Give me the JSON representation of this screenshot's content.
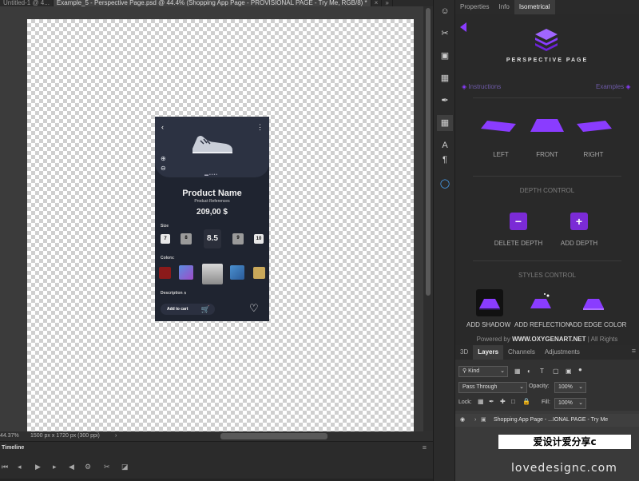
{
  "document_tabs": [
    {
      "label": "Untitled-1 @ 4...",
      "active": false
    },
    {
      "label": "Example_5 - Perspective Page.psd @ 44.4% (Shopping App Page - PROVISIONAL PAGE - Try Me, RGB/8) *",
      "active": true
    },
    {
      "label": "×",
      "active": false
    },
    {
      "label": "»",
      "active": false
    }
  ],
  "phone": {
    "product_name": "Product Name",
    "product_ref": "Product References",
    "price": "209,00 $",
    "size_label": "Size",
    "sizes": [
      "7",
      "8",
      "8.5",
      "9",
      "10"
    ],
    "colors_label": "Colors:",
    "description_label": "Description ∧",
    "add_to_cart": "Add to cart",
    "colors": [
      "#8b1a1a",
      "#7a5ab8",
      "#b5b5b5",
      "#3a7bc8",
      "#c9a85a"
    ]
  },
  "status": {
    "zoom": "44.37%",
    "dimensions": "1500 px x 1720 px (300 ppi)",
    "arrow": "›"
  },
  "timeline": {
    "title": "Timeline",
    "controls": [
      "⏮",
      "◂",
      "▶",
      "▸",
      "◀",
      "⚙",
      "✂",
      "◪"
    ]
  },
  "right_tabs": {
    "tabs": [
      "Properties",
      "Info",
      "Isometrical"
    ],
    "active": "Isometrical"
  },
  "isometrical": {
    "title": "PERSPECTIVE PAGE",
    "instructions": "Instructions",
    "examples": "Examples",
    "views": [
      "LEFT",
      "FRONT",
      "RIGHT"
    ],
    "depth_heading": "DEPTH CONTROL",
    "delete_depth": "DELETE DEPTH",
    "add_depth": "ADD DEPTH",
    "styles_heading": "STYLES CONTROL",
    "styles": [
      "ADD SHADOW",
      "ADD REFLECTION",
      "ADD EDGE COLOR"
    ],
    "powered_prefix": "Powered by",
    "powered_site": "WWW.OXYGENART.NET",
    "powered_suffix": "| All Rights",
    "accent": "#8a3cff"
  },
  "layers": {
    "tabs": [
      "3D",
      "Layers",
      "Channels",
      "Adjustments"
    ],
    "active": "Layers",
    "filter": "Kind",
    "blend_mode": "Pass Through",
    "opacity_label": "Opacity:",
    "opacity": "100%",
    "lock_label": "Lock:",
    "fill_label": "Fill:",
    "fill": "100%",
    "row_label": "Shopping App Page - ...IONAL PAGE - Try Me"
  },
  "watermark": {
    "banner": "爱设计爱分享c",
    "site": "lovedesignc.com"
  }
}
